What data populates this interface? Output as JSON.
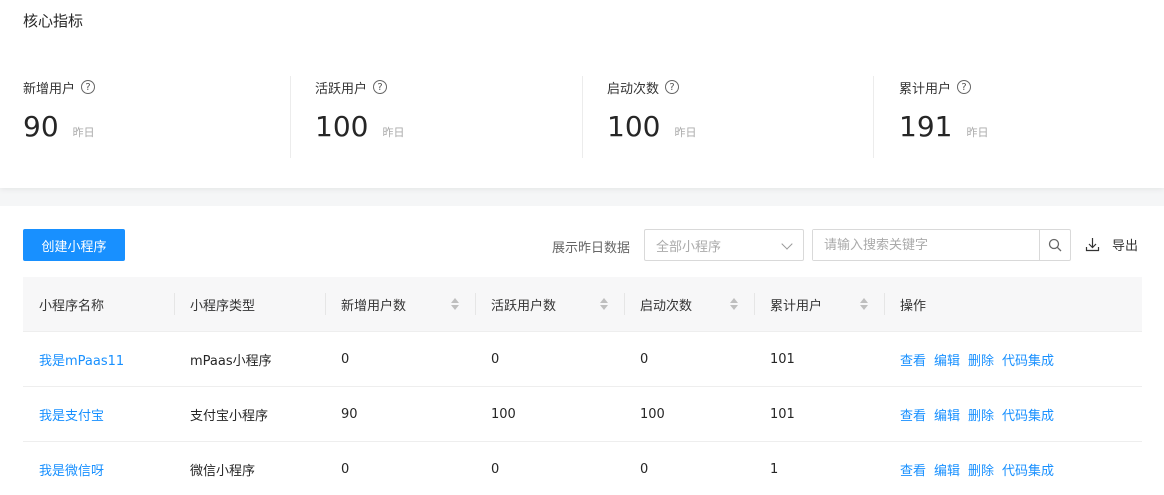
{
  "metrics": {
    "title": "核心指标",
    "items": [
      {
        "label": "新增用户",
        "value": "90",
        "sub": "昨日"
      },
      {
        "label": "活跃用户",
        "value": "100",
        "sub": "昨日"
      },
      {
        "label": "启动次数",
        "value": "100",
        "sub": "昨日"
      },
      {
        "label": "累计用户",
        "value": "191",
        "sub": "昨日"
      }
    ]
  },
  "toolbar": {
    "create_label": "创建小程序",
    "filter_label": "展示昨日数据",
    "select_value": "全部小程序",
    "search_placeholder": "请输入搜索关键字",
    "export_label": "导出"
  },
  "table": {
    "headers": [
      "小程序名称",
      "小程序类型",
      "新增用户数",
      "活跃用户数",
      "启动次数",
      "累计用户",
      "操作"
    ],
    "rows": [
      {
        "name": "我是mPaas11",
        "type": "mPaas小程序",
        "new": "0",
        "active": "0",
        "launch": "0",
        "total": "101"
      },
      {
        "name": "我是支付宝",
        "type": "支付宝小程序",
        "new": "90",
        "active": "100",
        "launch": "100",
        "total": "101"
      },
      {
        "name": "我是微信呀",
        "type": "微信小程序",
        "new": "0",
        "active": "0",
        "launch": "0",
        "total": "1"
      }
    ],
    "actions": [
      "查看",
      "编辑",
      "删除",
      "代码集成"
    ]
  },
  "colors": {
    "accent": "#1890ff"
  },
  "icons": {
    "help": "question-circle-icon",
    "search": "search-icon",
    "export": "download-icon",
    "select": "chevron-down-icon",
    "sort": "sort-icon"
  }
}
